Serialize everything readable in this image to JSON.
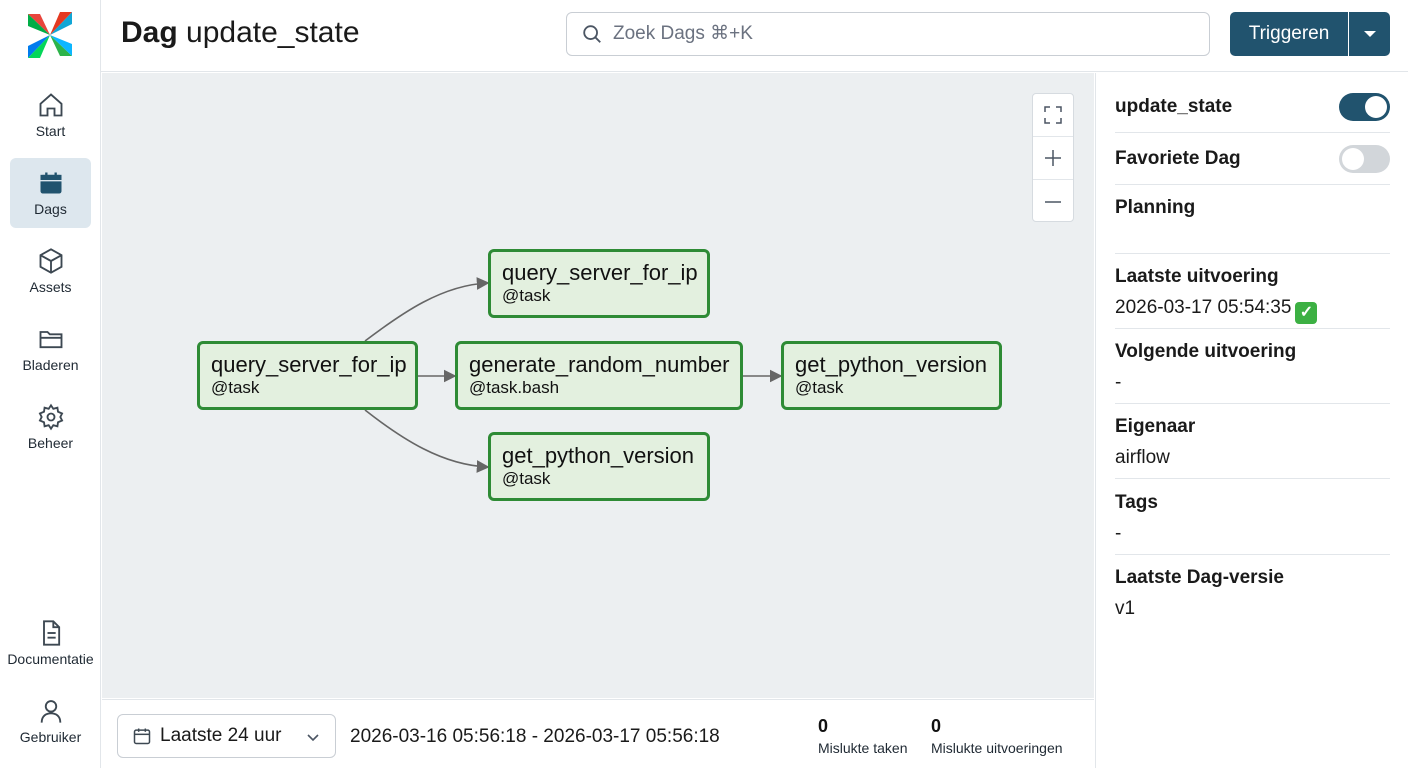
{
  "header": {
    "title_prefix": "Dag",
    "title_name": "update_state",
    "search_placeholder": "Zoek Dags ⌘+K",
    "trigger_label": "Triggeren"
  },
  "sidebar": {
    "items": [
      {
        "label": "Start",
        "icon": "home-icon"
      },
      {
        "label": "Dags",
        "icon": "calendar-icon"
      },
      {
        "label": "Assets",
        "icon": "cube-icon"
      },
      {
        "label": "Bladeren",
        "icon": "folder-icon"
      },
      {
        "label": "Beheer",
        "icon": "gear-icon"
      },
      {
        "label": "Documentatie",
        "icon": "document-icon"
      },
      {
        "label": "Gebruiker",
        "icon": "user-icon"
      }
    ],
    "active": "Dags"
  },
  "graph": {
    "nodes": [
      {
        "name": "query_server_for_ip",
        "type": "@task"
      },
      {
        "name": "query_server_for_ip",
        "type": "@task"
      },
      {
        "name": "generate_random_number",
        "type": "@task.bash"
      },
      {
        "name": "get_python_version",
        "type": "@task"
      },
      {
        "name": "get_python_version",
        "type": "@task"
      }
    ],
    "status_color": "#2e8b35"
  },
  "bottom": {
    "range_label": "Laatste 24 uur",
    "date_range": "2026-03-16 05:56:18 - 2026-03-17 05:56:18",
    "failed_tasks_count": "0",
    "failed_tasks_label": "Mislukte taken",
    "failed_runs_count": "0",
    "failed_runs_label": "Mislukte uitvoeringen"
  },
  "panel": {
    "dag_toggle_label": "update_state",
    "dag_toggle_on": true,
    "favorite_label": "Favoriete Dag",
    "favorite_on": false,
    "planning_label": "Planning",
    "last_run_label": "Laatste uitvoering",
    "last_run_value": "2026-03-17 05:54:35",
    "next_run_label": "Volgende uitvoering",
    "next_run_value": "-",
    "owner_label": "Eigenaar",
    "owner_value": "airflow",
    "tags_label": "Tags",
    "tags_value": "-",
    "version_label": "Laatste Dag-versie",
    "version_value": "v1"
  },
  "colors": {
    "accent": "#21536e",
    "node_fill": "#e3f0df",
    "canvas": "#eceff1"
  }
}
